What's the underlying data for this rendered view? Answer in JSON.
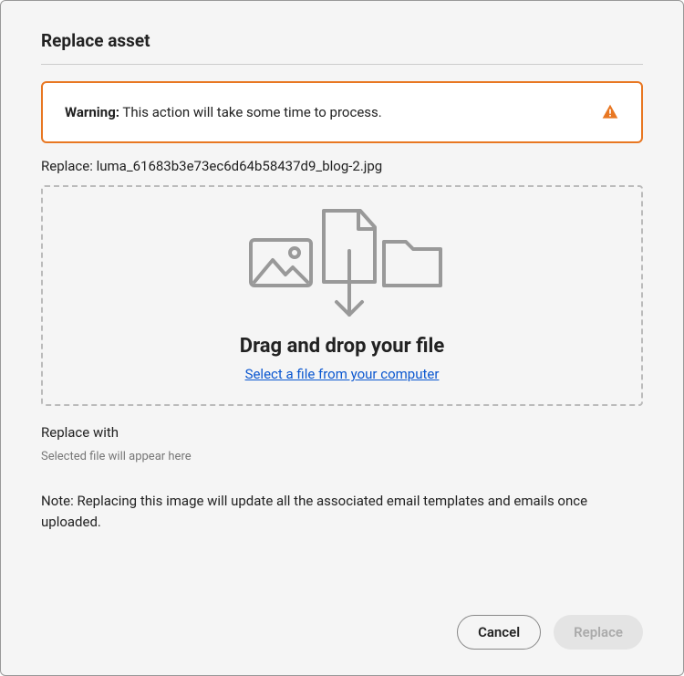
{
  "dialog": {
    "title": "Replace asset"
  },
  "warning": {
    "label_bold": "Warning:",
    "label_rest": " This action will take some time to process."
  },
  "replace": {
    "prefix": "Replace: ",
    "filename": "luma_61683b3e73ec6d64b58437d9_blog-2.jpg"
  },
  "dropzone": {
    "title": "Drag and drop your file",
    "link": "Select a file from your computer"
  },
  "replace_with": {
    "label": "Replace with",
    "placeholder": "Selected file will appear here"
  },
  "note": "Note: Replacing this image will update all the associated email templates and emails once uploaded.",
  "buttons": {
    "cancel": "Cancel",
    "replace": "Replace"
  }
}
